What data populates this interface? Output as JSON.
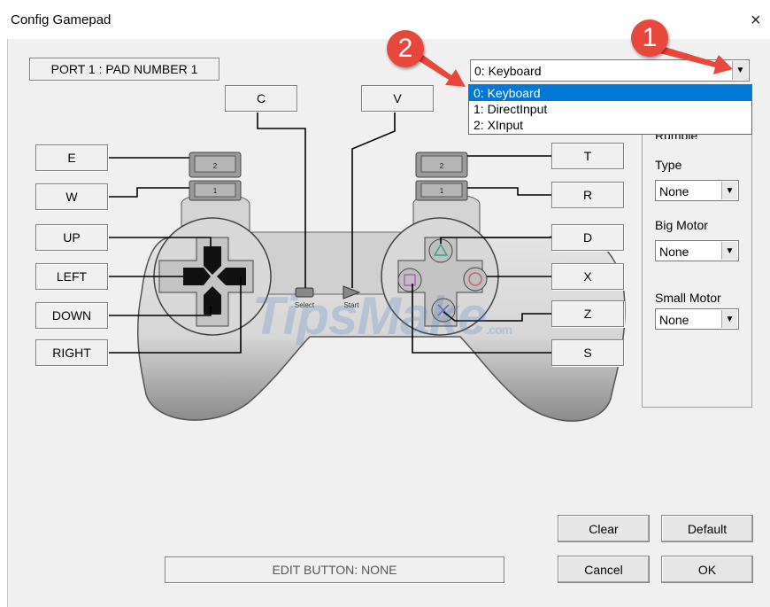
{
  "window": {
    "title": "Config Gamepad",
    "close_symbol": "×"
  },
  "port_label": "PORT 1 : PAD NUMBER 1",
  "device": {
    "selected": "0: Keyboard",
    "options": [
      "0: Keyboard",
      "1: DirectInput",
      "2: XInput"
    ],
    "selected_index": 0
  },
  "mappings": {
    "l2": "E",
    "l1": "W",
    "up": "UP",
    "left": "LEFT",
    "down": "DOWN",
    "right": "RIGHT",
    "select": "C",
    "start": "V",
    "r2": "T",
    "r1": "R",
    "triangle": "D",
    "circle": "X",
    "cross": "Z",
    "square": "S"
  },
  "rumble": {
    "group_label": "Rumble",
    "type_label": "Type",
    "type_value": "None",
    "big_label": "Big Motor",
    "big_value": "None",
    "small_label": "Small Motor",
    "small_value": "None"
  },
  "controller": {
    "select_label": "Select",
    "start_label": "Start",
    "trigger_upper": "2",
    "trigger_lower": "1"
  },
  "watermark": "TipsMake",
  "watermark_suffix": ".com",
  "status": "EDIT BUTTON: NONE",
  "buttons": {
    "clear": "Clear",
    "default": "Default",
    "cancel": "Cancel",
    "ok": "OK"
  },
  "annotations": {
    "badge1": "1",
    "badge2": "2"
  },
  "colors": {
    "annotation": "#e8473b",
    "selection": "#0078d7"
  }
}
